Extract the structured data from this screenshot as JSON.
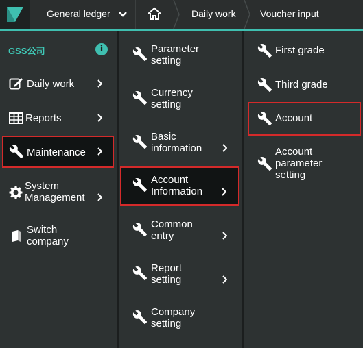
{
  "topbar": {
    "module": "General ledger",
    "breadcrumb": [
      "Daily work",
      "Voucher input"
    ]
  },
  "company": {
    "name": "GSS公司"
  },
  "sidebar": {
    "items": [
      {
        "label": "Daily work",
        "icon": "edit-icon",
        "has_submenu": true
      },
      {
        "label": "Reports",
        "icon": "table-icon",
        "has_submenu": true
      },
      {
        "label": "Maintenance",
        "icon": "wrench-icon",
        "has_submenu": true,
        "selected": true
      },
      {
        "label_line1": "System",
        "label_line2": "Management",
        "icon": "gear-icon",
        "has_submenu": true
      },
      {
        "label_line1": "Switch",
        "label_line2": "company",
        "icon": "book-icon",
        "has_submenu": false
      }
    ]
  },
  "submenu": {
    "items": [
      {
        "label_line1": "Parameter",
        "label_line2": "setting",
        "has_submenu": false
      },
      {
        "label_line1": "Currency",
        "label_line2": "setting",
        "has_submenu": false
      },
      {
        "label_line1": "Basic",
        "label_line2": "information",
        "has_submenu": true
      },
      {
        "label_line1": "Account",
        "label_line2": "Information",
        "has_submenu": true,
        "selected": true
      },
      {
        "label_line1": "Common",
        "label_line2": "entry",
        "has_submenu": true
      },
      {
        "label_line1": "Report",
        "label_line2": "setting",
        "has_submenu": true
      },
      {
        "label_line1": "Company",
        "label_line2": "setting",
        "has_submenu": false
      }
    ]
  },
  "subsubmenu": {
    "items": [
      {
        "label": "First grade"
      },
      {
        "label": "Third grade"
      },
      {
        "label": "Account",
        "highlighted": true
      },
      {
        "label_line1": "Account",
        "label_line2": "parameter",
        "label_line3": "setting"
      }
    ]
  },
  "colors": {
    "accent": "#3fbfb0",
    "highlight_border": "#d42a2a",
    "panel": "#2d3232",
    "selected_bg": "#111414"
  }
}
